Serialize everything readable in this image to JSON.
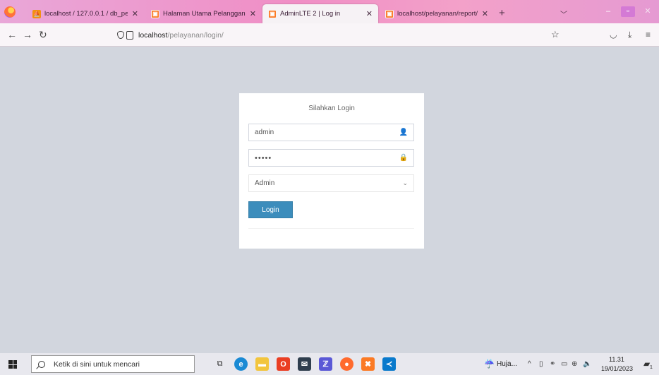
{
  "browser": {
    "tabs": [
      {
        "label": "localhost / 127.0.0.1 / db_pelay",
        "icon": "phpmyadmin-icon"
      },
      {
        "label": "Halaman Utama Pelanggan",
        "icon": "xampp-icon"
      },
      {
        "label": "AdminLTE 2 | Log in",
        "icon": "xampp-icon",
        "active": true
      },
      {
        "label": "localhost/pelayanan/report/ce",
        "icon": "xampp-icon"
      }
    ],
    "url_host": "localhost",
    "url_path": "/pelayanan/login/"
  },
  "login": {
    "message": "Silahkan Login",
    "username": "admin",
    "password_mask": "•••••",
    "role": "Admin",
    "button_label": "Login"
  },
  "taskbar": {
    "search_placeholder": "Ketik di sini untuk mencari",
    "weather": "Huja...",
    "time": "11.31",
    "date": "19/01/2023",
    "notification_count": "1"
  },
  "colors": {
    "page_bg": "#d2d6de",
    "button": "#3c8dbc",
    "tabbar": "#f08ec5"
  }
}
